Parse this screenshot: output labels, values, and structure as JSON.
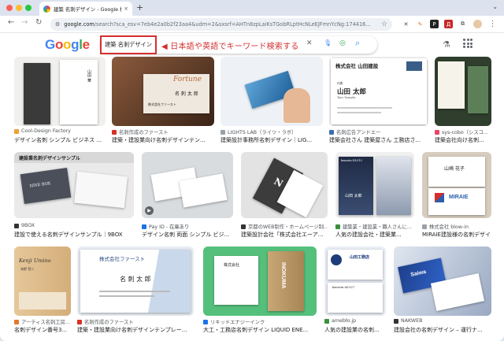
{
  "browser": {
    "tab_title": "建築 名刺デザイン - Google 検索",
    "tab_close": "×",
    "new_tab": "+",
    "tab_menu": "⌄",
    "url_host": "google.com",
    "url_path": "/search?sca_esv=7eb4e2a0b2f23aa4&udm=2&sxsrf=AHTn8zpLaiKsTGobRLptHcNLeEJFmnYcNg:174416...",
    "back": "←",
    "forward": "→",
    "reload": "↻",
    "site_info": "⚙",
    "bookmark": "☆",
    "extensions": [
      "✕",
      "✎",
      "P",
      "Д",
      "⧉"
    ],
    "menu": "⋮"
  },
  "google": {
    "logo": "Google",
    "query": "建築 名刺デザイン",
    "annotation": "◀ 日本語や英語でキーワード検索する",
    "clear_icon": "✕",
    "mic_icon": "🎙",
    "lens_icon": "◎",
    "search_icon": "⌕",
    "labs_icon": "⚗"
  },
  "results": [
    {
      "source": "Cool-Design Factory",
      "title": "デザイン名刺 シンプル ビジネス ...",
      "fav_color": "#f0a030"
    },
    {
      "source": "名刺作成のファースト",
      "title": "建築・建設業向け名刺デザインテン...",
      "fav_color": "#d93025"
    },
    {
      "source": "LIGHTS LAB（ライツ・ラボ）",
      "title": "建築設計事務所名刺デザイン｜LIG...",
      "fav_color": "#9aa0a6"
    },
    {
      "source": "名刺広告アンドエー",
      "title": "建築会社さん 建築屋さん 工務店さ...",
      "fav_color": "#3c6db0"
    },
    {
      "source": "sys-cobo（シスコ...",
      "title": "建築会社向け名刺...",
      "fav_color": "#e8466a"
    },
    {
      "source": "9BOX",
      "title": "建設で使える名刺デザインサンプル｜9BOX",
      "fav_color": "#333333"
    },
    {
      "source": "Pay ID - 在庫あり",
      "title": "デザイン名刺 両面 シンプル ビジ...",
      "fav_color": "#1a73e8"
    },
    {
      "source": "京都のWEB制作・ホームページ制...",
      "title": "建築設計会社「株式会社エーア...",
      "fav_color": "#333333"
    },
    {
      "source": "建築業・建設業・職人さんに...",
      "title": "人気の建設会社・建築業...",
      "fav_color": "#3c8f3c"
    },
    {
      "source": "株式会社 blow-in",
      "title": "MIRAIE建設様の名刺デザイン",
      "fav_color": "#9aa0a6"
    },
    {
      "source": "アーティス名刺工房...",
      "title": "名刺デザイン番号3...",
      "fav_color": "#e07a2e"
    },
    {
      "source": "名刺作成のファースト",
      "title": "建築・建設業向け名刺デザインテンプレー...",
      "fav_color": "#d93025"
    },
    {
      "source": "リキッドエナジーインク",
      "title": "大工・工務店名刺デザイン LIQUID ENE...",
      "fav_color": "#1a73e8"
    },
    {
      "source": "amebło.jp",
      "title": "人気の建設業の名刺...",
      "fav_color": "#3c8f3c"
    },
    {
      "source": "NAKWEB",
      "title": "建設会社の名刺デザイン – 運行ナ...",
      "fav_color": "#333333"
    }
  ],
  "thumb_text": {
    "r1a_name": "山田 華",
    "r1b_brand": "Fortune",
    "r1b_name": "名 刺 太 郎",
    "r1b_company": "株式会社ファースト",
    "r1d_company": "株式会社 山田建設",
    "r1d_name": "山田 太郎",
    "r1d_roman": "Taro Yamada",
    "r1d_role": "代表",
    "r2a_header": "建設業名刺デザインサンプル",
    "r2a_card": "HIVE BOX",
    "r2c_logo": "N",
    "r2d_company": "kenzetu-NI-010",
    "r2d_name": "山田 太郎",
    "r2e_name": "山崎 花子",
    "r2e_brand": "MIRAIE",
    "r3a_name": "Kenji Umino",
    "r3a_subtitle": "海野 賢二",
    "r3b_company": "株式会社ファースト",
    "r3b_name": "名 刺 太 郎",
    "r3c_company": "株式会社",
    "r3c_name": "INOKUMA",
    "r3d_company": "山田工務店",
    "r3d_code": "kenzetu-AY-027",
    "r3e_brand": "Saiwa"
  }
}
